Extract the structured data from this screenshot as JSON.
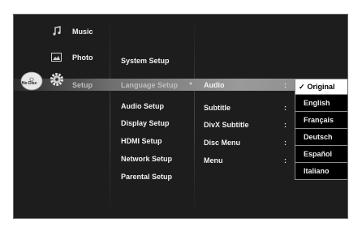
{
  "main_menu": {
    "music": "Music",
    "photo": "Photo",
    "setup": "Setup",
    "disc_status": "No Disc"
  },
  "setup_menu": {
    "system_setup": "System Setup",
    "language_setup": "Language Setup",
    "audio_setup": "Audio Setup",
    "display_setup": "Display Setup",
    "hdmi_setup": "HDMI Setup",
    "network_setup": "Network Setup",
    "parental_setup": "Parental Setup"
  },
  "language_options": {
    "audio": "Audio",
    "subtitle": "Subtitle",
    "divx_subtitle": "DivX Subtitle",
    "disc_menu": "Disc Menu",
    "menu": "Menu",
    "separator": ":"
  },
  "audio_dropdown": {
    "check": "✓",
    "items": [
      "Original",
      "English",
      "Français",
      "Deutsch",
      "Español",
      "Italiano"
    ]
  }
}
